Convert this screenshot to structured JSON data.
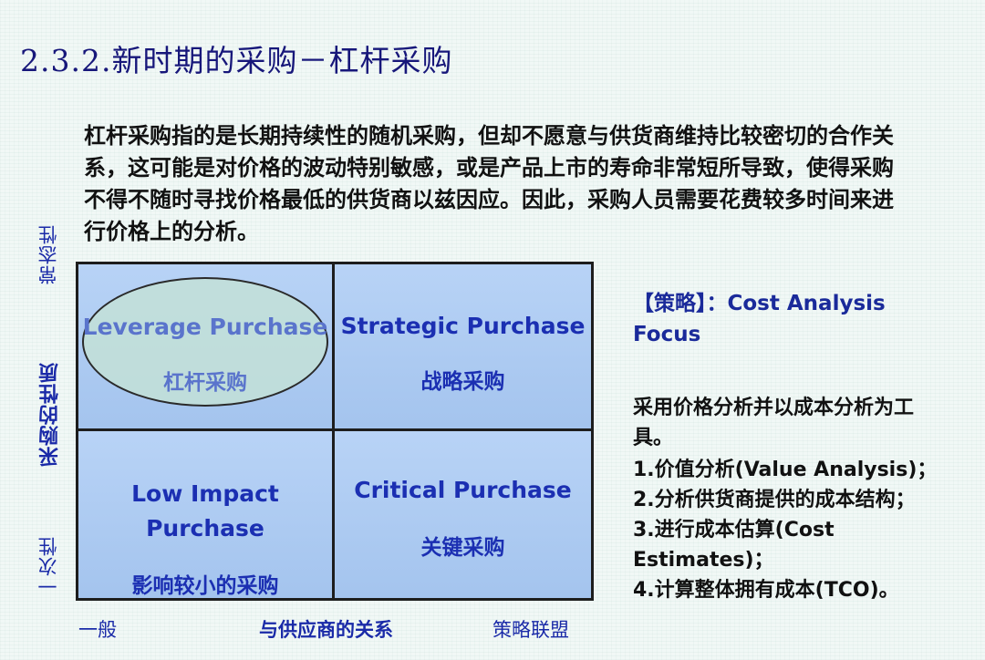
{
  "title": "2.3.2.新时期的采购－杠杆采购",
  "intro": "杠杆采购指的是长期持续性的随机采购，但却不愿意与供货商维持比较密切的合作关系，这可能是对价格的波动特别敏感，或是产品上市的寿命非常短所导致，使得采购不得不随时寻找价格最低的供货商以兹因应。因此，采购人员需要花费较多时间来进行价格上的分析。",
  "y_axis": {
    "top": "常态性",
    "middle": "采购的性质",
    "bottom": "一次性"
  },
  "x_axis": {
    "left": "一般",
    "middle": "与供应商的关系",
    "right": "策略联盟"
  },
  "quadrants": {
    "top_left": {
      "en": "Leverage Purchase",
      "cn": "杠杆采购"
    },
    "top_right": {
      "en": "Strategic Purchase",
      "cn": "战略采购"
    },
    "bottom_left": {
      "en_line1": "Low Impact",
      "en_line2": "Purchase",
      "cn": "影响较小的采购"
    },
    "bottom_right": {
      "en": "Critical Purchase",
      "cn": "关键采购"
    }
  },
  "strategy": {
    "label": "【策略】：Cost Analysis Focus"
  },
  "details": {
    "lead": "采用价格分析并以成本分析为工具。",
    "items": [
      "1.价值分析(Value Analysis)；",
      "2.分析供货商提供的成本结构；",
      "3.进行成本估算(Cost Estimates)；",
      "4.计算整体拥有成本(TCO)。"
    ]
  },
  "colors": {
    "title": "#17177a",
    "quadrant_text": "#1b2fb2",
    "quadrant_fill": "#a9c8f0",
    "highlight_ellipse": "#c3e1d7"
  }
}
